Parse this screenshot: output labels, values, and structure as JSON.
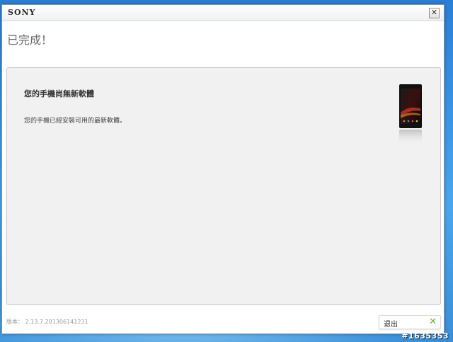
{
  "window": {
    "brand": "SONY",
    "close_glyph": "✕"
  },
  "header": {
    "title": "已完成！"
  },
  "message": {
    "title": "您的手機尚無新軟體",
    "body": "您的手機已經安裝可用的最新軟體。"
  },
  "footer": {
    "version": "版本： 2.13.7.201306141231",
    "exit_label": "退出",
    "exit_icon": "✕"
  },
  "watermark": "#1635353",
  "colors": {
    "accent_green": "#6cb33f",
    "desktop_blue": "#3b95e6"
  },
  "icons": {
    "close": "close-icon",
    "exit": "close-icon",
    "device": "phone-image"
  }
}
